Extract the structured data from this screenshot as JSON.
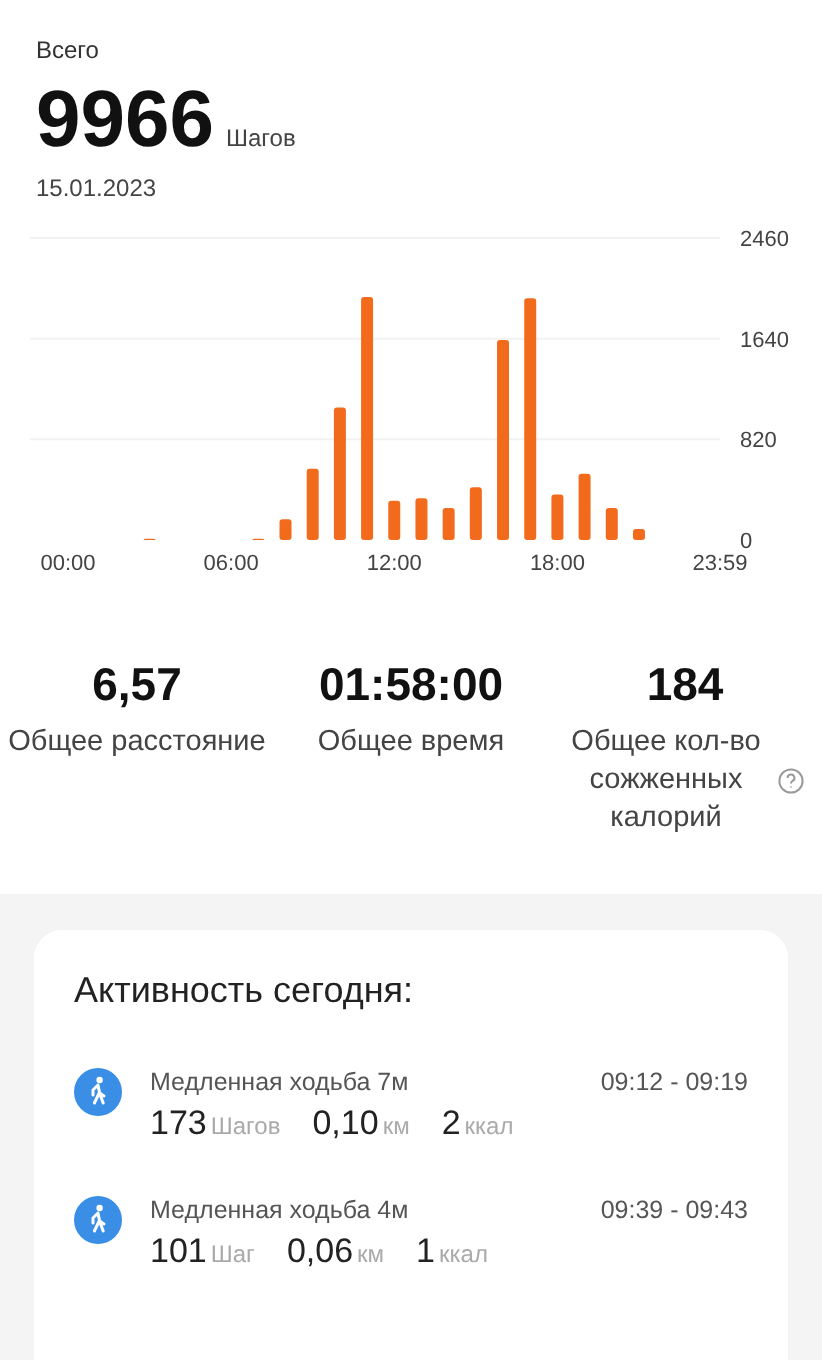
{
  "header": {
    "label": "Всего",
    "steps": "9966",
    "steps_unit": "Шагов",
    "date": "15.01.2023"
  },
  "chart": {
    "chart_data": {
      "type": "bar",
      "x": [
        0,
        1,
        2,
        3,
        4,
        5,
        6,
        7,
        8,
        9,
        10,
        11,
        12,
        13,
        14,
        15,
        16,
        17,
        18,
        19,
        20,
        21,
        22,
        23
      ],
      "values": [
        0,
        0,
        0,
        10,
        0,
        0,
        0,
        10,
        170,
        580,
        1080,
        1980,
        320,
        340,
        260,
        430,
        1630,
        1970,
        370,
        540,
        260,
        90,
        0,
        0
      ],
      "ylim": [
        0,
        2460
      ],
      "yticks": [
        0,
        820,
        1640,
        2460
      ],
      "xlim": [
        0,
        23.98
      ],
      "xticks": [
        {
          "value": 0,
          "label": "00:00"
        },
        {
          "value": 6,
          "label": "06:00"
        },
        {
          "value": 12,
          "label": "12:00"
        },
        {
          "value": 18,
          "label": "18:00"
        },
        {
          "value": 23.98,
          "label": "23:59"
        }
      ]
    }
  },
  "stats": [
    {
      "value": "6,57",
      "label": "Общее расстояние",
      "help": false
    },
    {
      "value": "01:58:00",
      "label": "Общее время",
      "help": false
    },
    {
      "value": "184",
      "label": "Общее кол-во сожженных калорий",
      "help": true
    }
  ],
  "activity": {
    "title": "Активность сегодня:",
    "items": [
      {
        "name": "Медленная ходьба 7м",
        "time": "09:12 - 09:19",
        "steps": "173",
        "steps_unit": "Шагов",
        "distance": "0,10",
        "distance_unit": "км",
        "calories": "2",
        "calories_unit": "ккал"
      },
      {
        "name": "Медленная ходьба 4м",
        "time": "09:39 - 09:43",
        "steps": "101",
        "steps_unit": "Шаг",
        "distance": "0,06",
        "distance_unit": "км",
        "calories": "1",
        "calories_unit": "ккал"
      }
    ]
  }
}
